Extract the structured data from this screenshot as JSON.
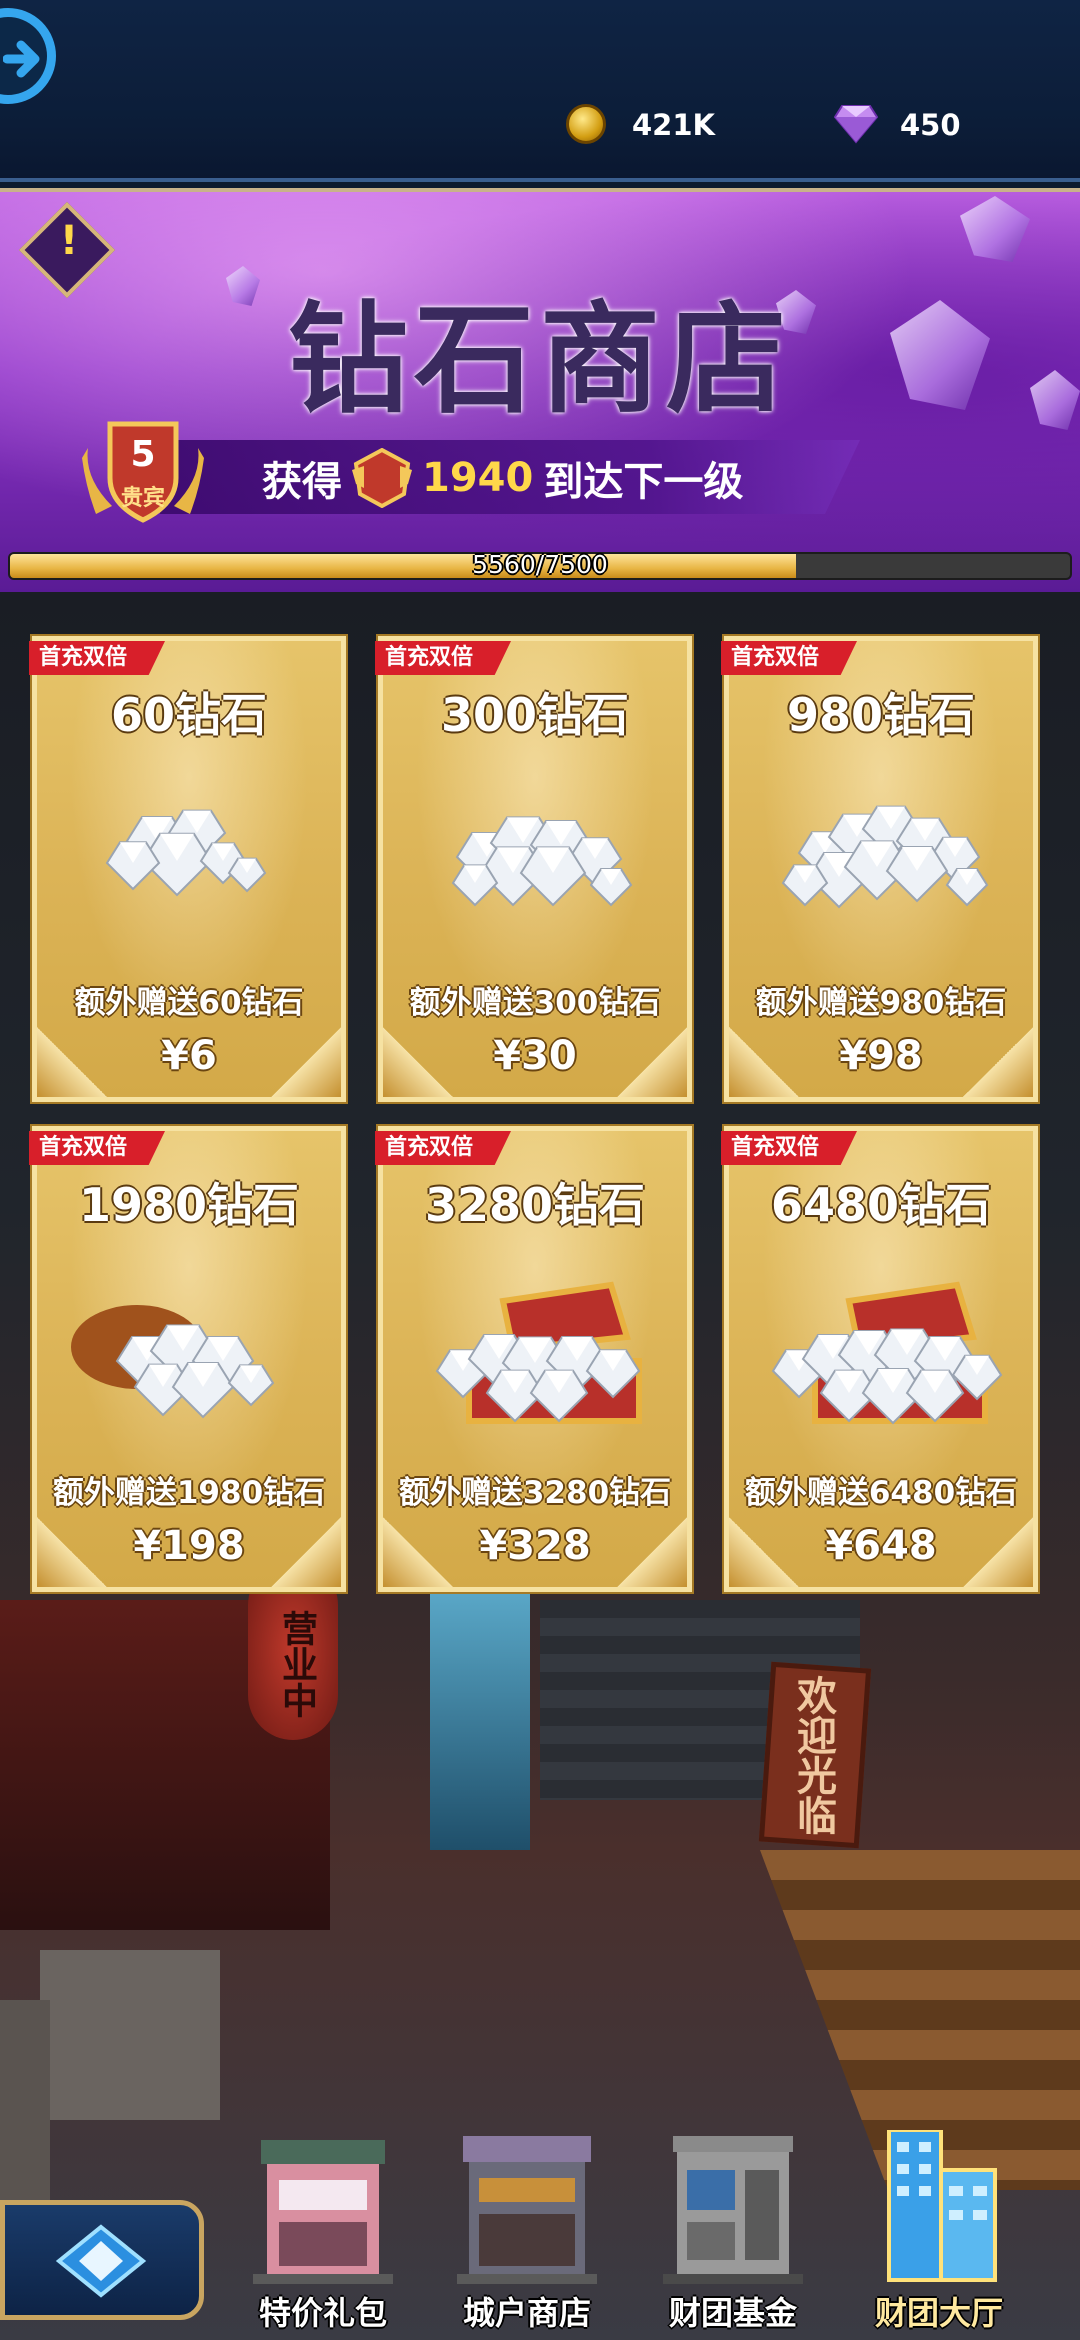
{
  "header": {
    "gold_amount": "421K",
    "diamond_amount": "450",
    "icons": [
      "back-arrow-icon",
      "gold-coin-icon",
      "diamond-icon"
    ]
  },
  "banner": {
    "title": "钻石商店",
    "vip_level": "5",
    "vip_rank_label": "贵宾",
    "progress_prefix": "获得",
    "progress_needed": "1940",
    "progress_suffix": "到达下一级",
    "progress_text": "5560/7500",
    "progress_value": 5560,
    "progress_max": 7500
  },
  "packs": [
    {
      "flag": "首充双倍",
      "name": "60钻石",
      "bonus": "额外赠送60钻石",
      "price": "¥6",
      "art": "small-pile"
    },
    {
      "flag": "首充双倍",
      "name": "300钻石",
      "bonus": "额外赠送300钻石",
      "price": "¥30",
      "art": "medium-pile"
    },
    {
      "flag": "首充双倍",
      "name": "980钻石",
      "bonus": "额外赠送980钻石",
      "price": "¥98",
      "art": "large-pile"
    },
    {
      "flag": "首充双倍",
      "name": "1980钻石",
      "bonus": "额外赠送1980钻石",
      "price": "¥198",
      "art": "bag"
    },
    {
      "flag": "首充双倍",
      "name": "3280钻石",
      "bonus": "额外赠送3280钻石",
      "price": "¥328",
      "art": "chest"
    },
    {
      "flag": "首充双倍",
      "name": "6480钻石",
      "bonus": "额外赠送6480钻石",
      "price": "¥648",
      "art": "big-chest"
    }
  ],
  "scene": {
    "lantern_text": "营业中",
    "sign_text": "欢迎光临"
  },
  "bottom_nav": [
    {
      "label": "特价礼包",
      "icon": "gift-shop-building-icon"
    },
    {
      "label": "城户商店",
      "icon": "store-building-icon"
    },
    {
      "label": "财团基金",
      "icon": "fund-building-icon"
    },
    {
      "label": "财团大厅",
      "icon": "hall-tower-icon",
      "selected": true
    }
  ],
  "colors": {
    "accent_blue": "#35a6ee",
    "banner_purple": "#8d35c8",
    "card_gold": "#dcb457",
    "flag_red": "#d81f2a",
    "progress_gold": "#e8b645"
  }
}
